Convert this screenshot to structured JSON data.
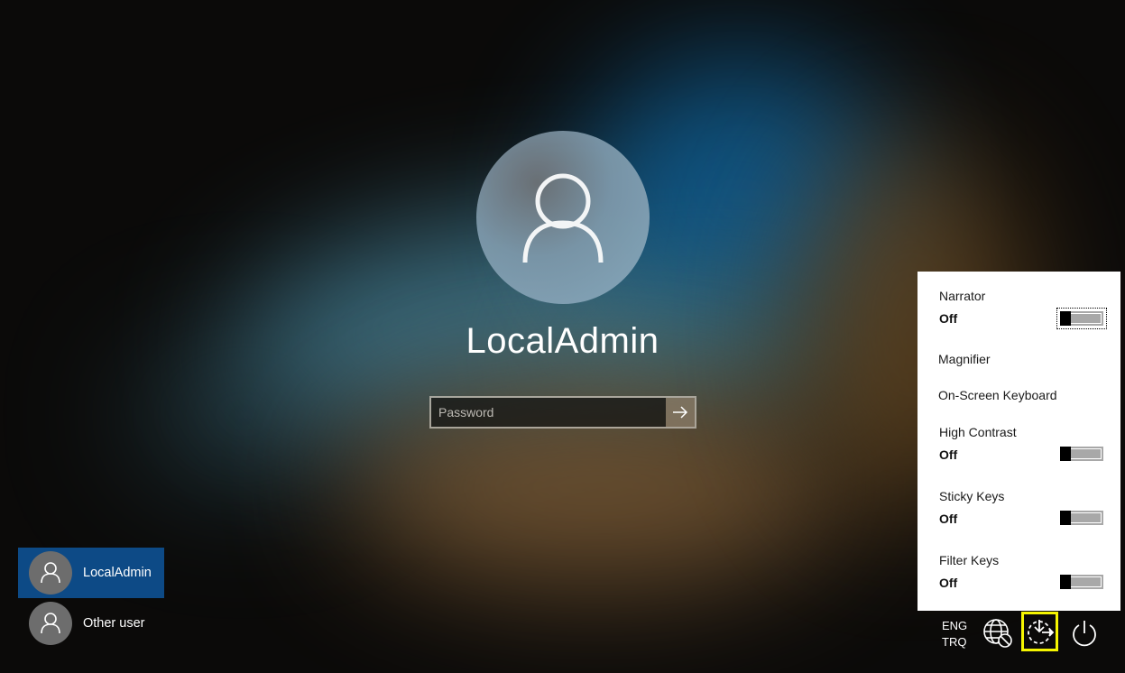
{
  "screen": "Windows sign-in screen",
  "user": {
    "name": "LocalAdmin",
    "password": {
      "value": "",
      "placeholder": "Password"
    },
    "submit_icon": "arrow-right-icon"
  },
  "user_list": [
    {
      "label": "LocalAdmin",
      "selected": true,
      "icon": "user-icon"
    },
    {
      "label": "Other user",
      "selected": false,
      "icon": "user-icon"
    }
  ],
  "ease_of_access": {
    "items": [
      {
        "label": "Narrator",
        "state": "Off",
        "toggle": true,
        "on": false,
        "focused": true
      },
      {
        "label": "Magnifier",
        "toggle": false
      },
      {
        "label": "On-Screen Keyboard",
        "toggle": false
      },
      {
        "label": "High Contrast",
        "state": "Off",
        "toggle": true,
        "on": false
      },
      {
        "label": "Sticky Keys",
        "state": "Off",
        "toggle": true,
        "on": false
      },
      {
        "label": "Filter Keys",
        "state": "Off",
        "toggle": true,
        "on": false
      }
    ]
  },
  "tray": {
    "language": {
      "line1": "ENG",
      "line2": "TRQ"
    },
    "network_icon": "globe-no-connection-icon",
    "ease_of_access_icon": "ease-of-access-icon",
    "power_icon": "power-icon"
  },
  "colors": {
    "selected_user_bg": "#0d4a86",
    "highlight": "#f5f500",
    "panel_bg": "#ffffff"
  }
}
